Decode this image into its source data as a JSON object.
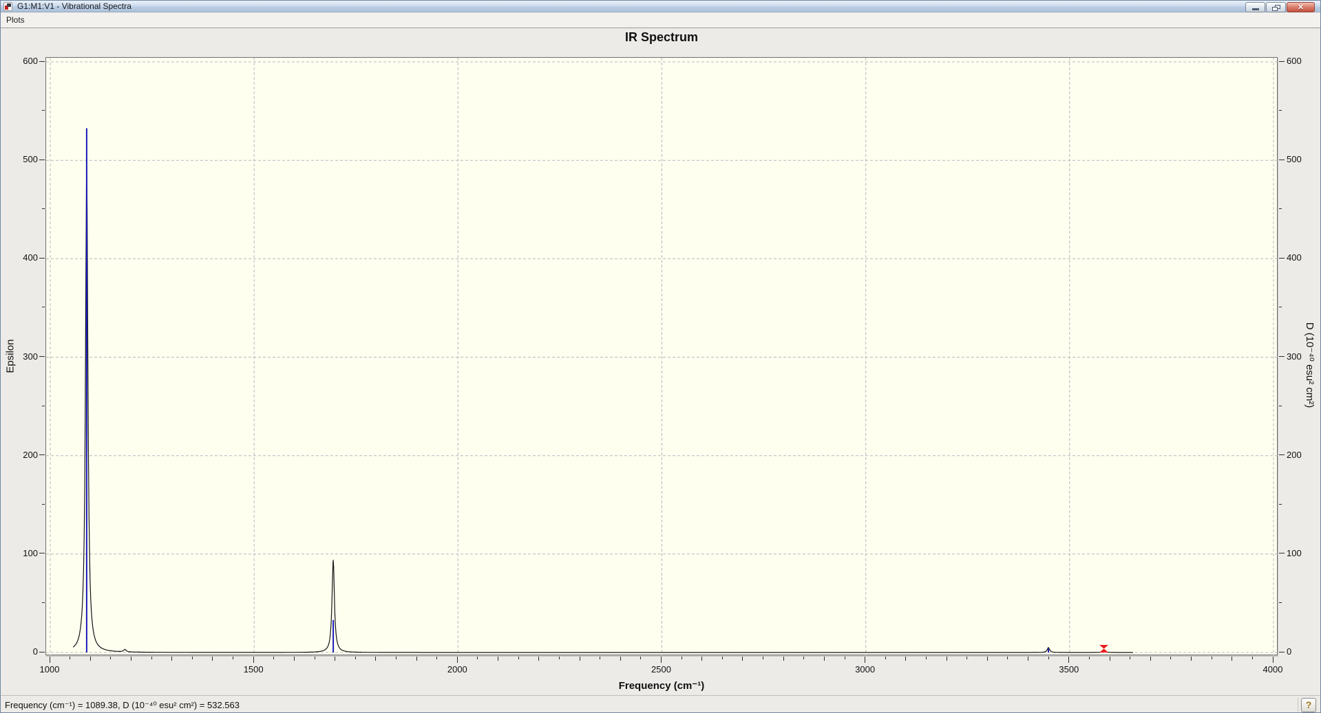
{
  "window": {
    "title": "G1:M1:V1 - Vibrational Spectra",
    "icon": "app-icon",
    "controls": [
      {
        "name": "minimize-button",
        "icon": "minimize-icon"
      },
      {
        "name": "restore-button",
        "icon": "restore-icon"
      },
      {
        "name": "close-button",
        "icon": "close-icon",
        "glyph": "✕"
      }
    ]
  },
  "menu": {
    "items": [
      {
        "label": "Plots"
      }
    ]
  },
  "chart_data": {
    "type": "line",
    "title": "IR Spectrum",
    "xlabel": "Frequency (cm⁻¹)",
    "ylabel_left": "Epsilon",
    "ylabel_right": "D (10⁻⁴⁰ esu² cm²)",
    "xlim": [
      1000,
      4000
    ],
    "ylim": [
      0,
      600
    ],
    "x_major_ticks": [
      1000,
      1500,
      2000,
      2500,
      3000,
      3500,
      4000
    ],
    "y_major_ticks": [
      0,
      100,
      200,
      300,
      400,
      500,
      600
    ],
    "x_minor_step": 50,
    "y_minor_step": 50,
    "grid": "dashed-major-both-axes",
    "legend": "none",
    "plot_bg": "#fffff0",
    "grid_color": "#b4b8bb",
    "curve_color": "#141414",
    "stick_color": "#1a1ab8",
    "marker_color": "#e81c1c",
    "curve_range": [
      1056,
      3656
    ],
    "lorentzian_gamma": 3.5,
    "peaks": [
      {
        "frequency": 1089.38,
        "epsilon": 495,
        "d": 532.563
      },
      {
        "frequency": 1183,
        "epsilon": 2.5,
        "d": 0
      },
      {
        "frequency": 1694,
        "epsilon": 94,
        "d": 33
      },
      {
        "frequency": 3448,
        "epsilon": 5,
        "d": 4
      },
      {
        "frequency": 3584,
        "epsilon": 2.5,
        "d": 0,
        "selected": true
      }
    ],
    "selected_marker": {
      "frequency": 3584
    }
  },
  "statusbar": {
    "readout": "Frequency (cm⁻¹) = 1089.38, D (10⁻⁴⁰ esu² cm²) = 532.563",
    "help_label": "?"
  }
}
